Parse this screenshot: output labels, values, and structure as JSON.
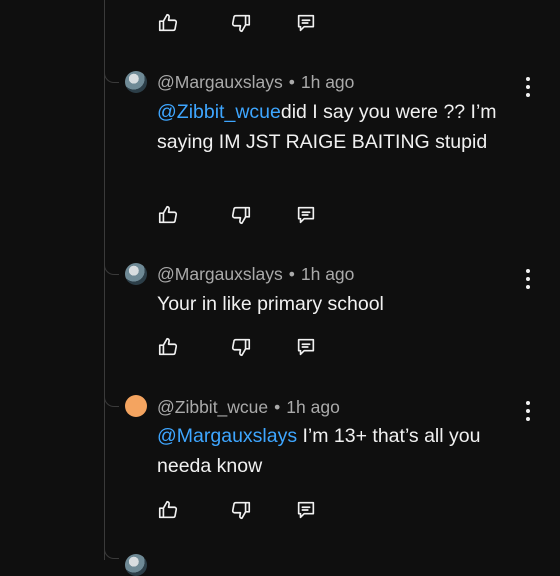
{
  "comments": [
    {
      "author": "@Margauxslays",
      "time": "1h ago",
      "mention": "@Zibbit_wcue",
      "body": "did I say you were ?? I’m saying IM JST RAIGE BAITING stupid"
    },
    {
      "author": "@Margauxslays",
      "time": "1h ago",
      "mention": "",
      "body": "Your in like primary school"
    },
    {
      "author": "@Zibbit_wcue",
      "time": "1h ago",
      "mention": "@Margauxslays",
      "body": " I’m 13+ that’s all you needa know"
    }
  ],
  "separator": "•",
  "icons": {
    "like": "thumbs-up-icon",
    "dislike": "thumbs-down-icon",
    "reply": "reply-comment-icon",
    "more": "more-vertical-icon"
  },
  "colors": {
    "background": "#0f0f0f",
    "mention": "#3ea6ff",
    "meta": "#aaaaaa",
    "avatar_orange": "#f4a460"
  }
}
